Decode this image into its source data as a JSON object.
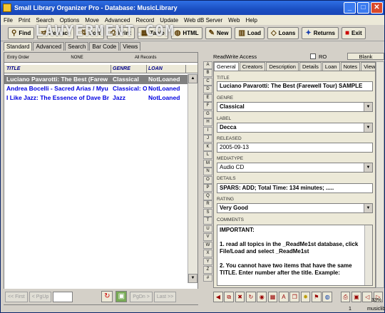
{
  "window": {
    "title": "Small Library Organizer Pro - Database: MusicLibrary"
  },
  "menu": [
    "File",
    "Print",
    "Search",
    "Options",
    "Move",
    "Advanced",
    "Record",
    "Update",
    "Web dB Server",
    "Web",
    "Help"
  ],
  "watermark": "LAWYERMENT.COM",
  "toolbar": [
    "Find",
    "Replace",
    "Sort",
    "Print",
    "Table",
    "HTML",
    "New",
    "Load",
    "Loans",
    "Returns",
    "Exit"
  ],
  "view_tabs": [
    "Standard",
    "Advanced",
    "Search",
    "Bar Code",
    "Views"
  ],
  "sortbar": [
    "Entry Order",
    "NONE",
    "All Records"
  ],
  "grid": {
    "headers": [
      "TITLE",
      "GENRE",
      "LOAN"
    ],
    "rows": [
      [
        "Luciano Pavarotti: The Best (Farew",
        "Classical",
        "NotLoaned"
      ],
      [
        "Andrea Bocelli - Sacred Arias / Myu",
        "Classical: O",
        "NotLoaned"
      ],
      [
        "I Like Jazz: The Essence of Dave Br",
        "Jazz",
        "NotLoaned"
      ]
    ]
  },
  "nav": {
    "first": "First",
    "pgup": "PgUp",
    "pgdn": "PgDn",
    "last": "Last"
  },
  "access": {
    "mode": "ReadWrite Access",
    "ro": "RO",
    "blank": "Blank"
  },
  "alphabet": [
    "A",
    "B",
    "C",
    "D",
    "E",
    "F",
    "G",
    "H",
    "I",
    "J",
    "K",
    "L",
    "M",
    "N",
    "O",
    "P",
    "Q",
    "R",
    "S",
    "T",
    "U",
    "V",
    "W",
    "X",
    "Y",
    "Z",
    "#"
  ],
  "detail_tabs": [
    "General",
    "Creators",
    "Description",
    "Details",
    "Loan",
    "Notes",
    "Views"
  ],
  "fields": {
    "title_label": "TITLE",
    "title": "Luciano Pavarotti: The Best (Farewell Tour)  SAMPLE",
    "genre_label": "GENRE",
    "genre": "Classical",
    "label_label": "LABEL",
    "label": "Decca",
    "released_label": "RELEASED",
    "released": "2005-09-13",
    "mediatype_label": "MEDIATYPE",
    "mediatype": "Audio CD",
    "details_label": "DETAILS",
    "details": "SPARS: ADD;     Total Time: 134 minutes;  .....",
    "rating_label": "RATING",
    "rating": "Very Good",
    "comments_label": "COMMENTS",
    "comments": [
      "IMPORTANT:",
      "1. read all topics in the _ReadMe1st database, click File/Load and select _ReadMe1st",
      "2. You cannot have two items that have the same TITLE. Enter number after the title. Example:"
    ]
  },
  "status": {
    "count": "1",
    "percent": "33%",
    "db": "musiclib"
  }
}
